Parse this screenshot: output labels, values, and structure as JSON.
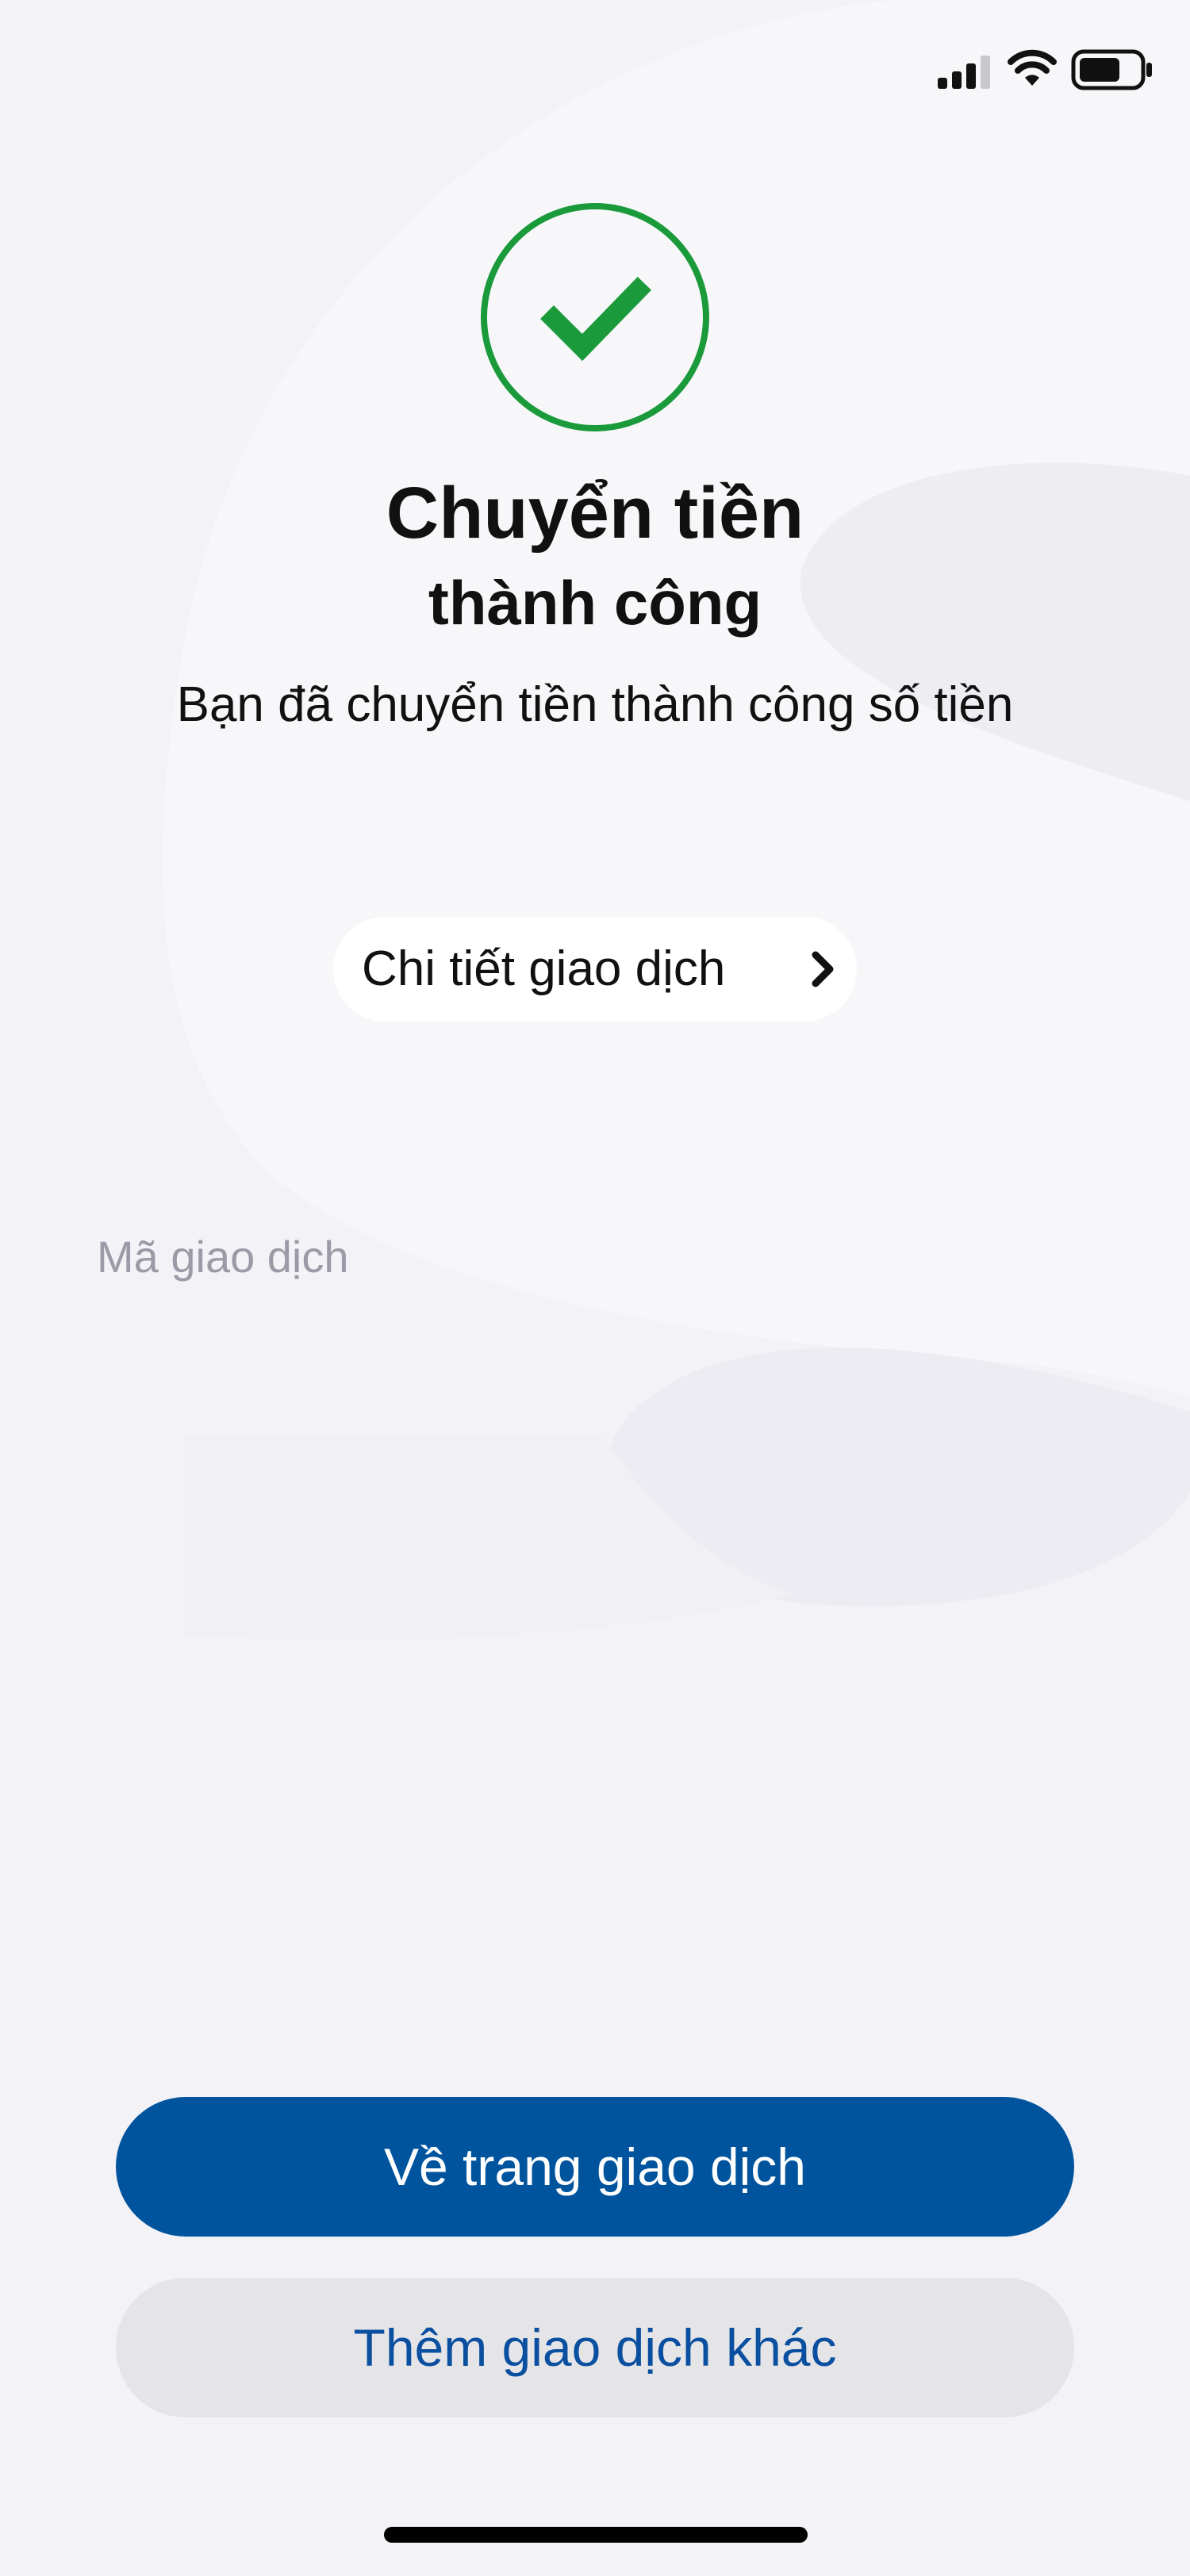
{
  "status_bar": {
    "signal_icon": "cellular-signal-icon",
    "wifi_icon": "wifi-icon",
    "battery_icon": "battery-icon"
  },
  "result": {
    "icon": "check-circle-icon",
    "icon_color": "#1a9a3a",
    "title": "Chuyển tiền",
    "subtitle": "thành công",
    "message": "Bạn đã chuyển tiền thành công số tiền"
  },
  "details_link": {
    "label": "Chi tiết giao dịch",
    "icon": "chevron-right-icon"
  },
  "transaction": {
    "id_label": "Mã giao dịch"
  },
  "actions": {
    "primary_label": "Về trang giao dịch",
    "primary_color": "#00549e",
    "secondary_label": "Thêm giao dịch khác",
    "secondary_color": "#e5e5e8"
  }
}
